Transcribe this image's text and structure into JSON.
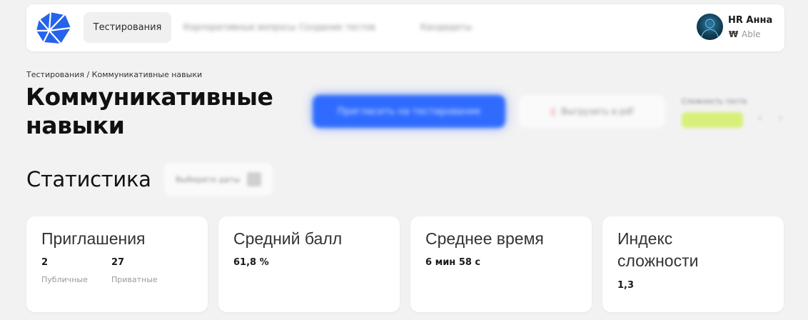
{
  "header": {
    "nav": {
      "active": "Тестирования",
      "blurred": [
        "Корпоративные вопросы",
        "Создание тестов",
        "Кандидаты"
      ]
    },
    "profile": {
      "name": "HR Анна",
      "coin_icon": "₩",
      "company": "Able"
    }
  },
  "breadcrumb": "Тестирования / Коммуникативные навыки",
  "page": {
    "title": "Коммуникативные навыки",
    "primary_button": "Пригласить на тестирование",
    "secondary_button": "Выгрузить в pdf",
    "side_label": "Сложность теста",
    "side_prev": "‹",
    "side_next": "›"
  },
  "stats": {
    "title": "Статистика",
    "filter_label": "Выберите даты",
    "cards": [
      {
        "title": "Приглашения",
        "values": [
          {
            "value": "2",
            "label": "Публичные"
          },
          {
            "value": "27",
            "label": "Приватные"
          }
        ]
      },
      {
        "title": "Средний балл",
        "value": "61,8 %"
      },
      {
        "title": "Среднее время",
        "value": "6 мин 58 с"
      },
      {
        "title": "Индекс сложности",
        "value": "1,3"
      }
    ]
  },
  "colors": {
    "accent": "#2f6bff",
    "background": "#f2f2f2",
    "badge": "#d8f07a"
  }
}
